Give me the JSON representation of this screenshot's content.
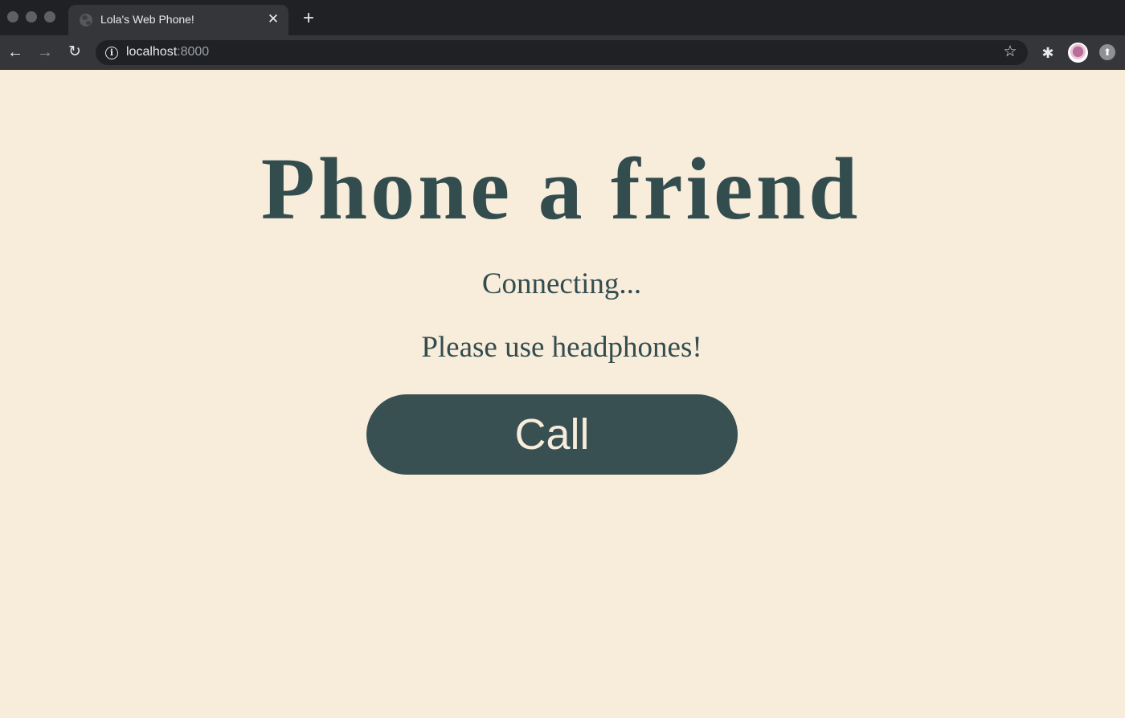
{
  "browser": {
    "tab": {
      "title": "Lola's Web Phone!",
      "favicon": "globe-icon",
      "close_glyph": "✕"
    },
    "new_tab_glyph": "+",
    "toolbar": {
      "back_glyph": "←",
      "forward_glyph": "→",
      "reload_glyph": "↻",
      "info_glyph": "i",
      "url_host": "localhost",
      "url_port": ":8000",
      "bookmark_glyph": "☆",
      "extensions_glyph": "✱",
      "update_glyph": "⬆"
    }
  },
  "page": {
    "heading": "Phone a friend",
    "status": "Connecting...",
    "note": "Please use headphones!",
    "call_button_label": "Call"
  },
  "colors": {
    "page_background": "#f8ecdb",
    "text_primary": "#334d4f",
    "button_background": "#395053",
    "button_text": "#f8ecdb"
  }
}
